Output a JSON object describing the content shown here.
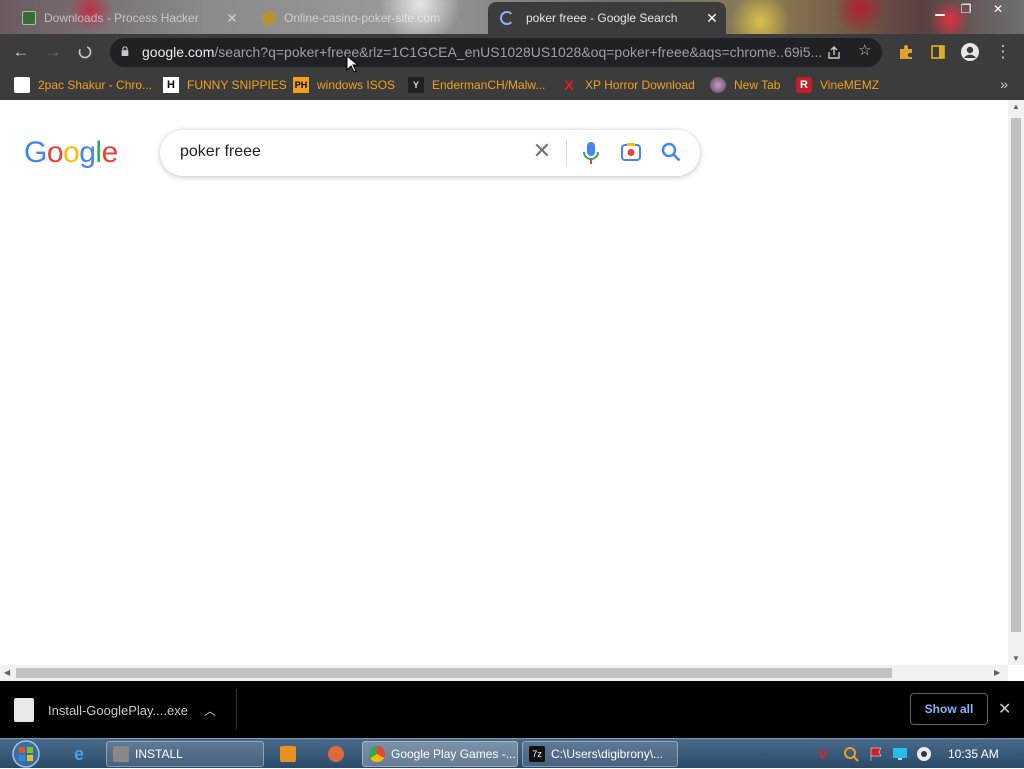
{
  "browser": {
    "tabs": [
      {
        "title": "Downloads - Process Hacker",
        "active": false
      },
      {
        "title": "Online-casino-poker-site.com",
        "active": false
      },
      {
        "title": "poker freee - Google Search",
        "active": true
      }
    ],
    "address": {
      "host": "google.com",
      "path": "/search?q=poker+freee&rlz=1C1GCEA_enUS1028US1028&oq=poker+freee&aqs=chrome..69i5..."
    },
    "bookmarks": [
      {
        "label": "2pac Shakur - Chro...",
        "icon": "bookmark-favicon-icon"
      },
      {
        "label": "FUNNY SNIPPIES",
        "icon": "H"
      },
      {
        "label": "windows ISOS",
        "icon": "PH"
      },
      {
        "label": "EndermanCH/Malw...",
        "icon": "Y"
      },
      {
        "label": "XP Horror Download",
        "icon": "X"
      },
      {
        "label": "New Tab",
        "icon": "globe-icon"
      },
      {
        "label": "VineMEMZ",
        "icon": "R"
      }
    ]
  },
  "page": {
    "logo": "Google",
    "search_query": "poker freee"
  },
  "downloads": {
    "item": "Install-GooglePlay....exe",
    "show_all": "Show all"
  },
  "taskbar": {
    "items": [
      {
        "label": "INSTALL"
      },
      {
        "label": "Google Play Games -..."
      },
      {
        "label": "C:\\Users\\digibrony\\..."
      }
    ],
    "clock": "10:35 AM"
  },
  "colors": {
    "accent_blue": "#1a73e8",
    "bookmark_text": "#f0a020",
    "toolbar": "#3c3c3c"
  }
}
